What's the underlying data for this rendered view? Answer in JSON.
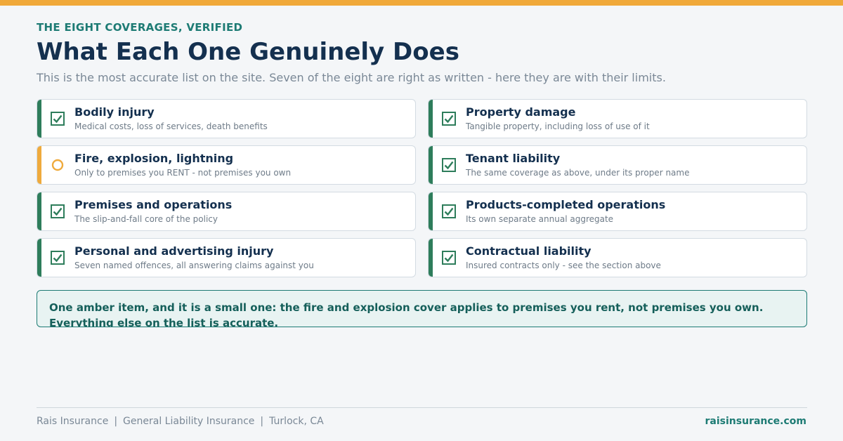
{
  "header": {
    "eyebrow": "THE EIGHT COVERAGES, VERIFIED",
    "title": "What Each One Genuinely Does",
    "subtitle": "This is the most accurate list on the site. Seven of the eight are right as written - here they are with their limits."
  },
  "coverages": [
    {
      "title": "Bodily injury",
      "desc": "Medical costs, loss of services, death benefits",
      "status": "verified"
    },
    {
      "title": "Property damage",
      "desc": "Tangible property, including loss of use of it",
      "status": "verified"
    },
    {
      "title": "Fire, explosion, lightning",
      "desc": "Only to premises you RENT - not premises you own",
      "status": "caution"
    },
    {
      "title": "Tenant liability",
      "desc": "The same coverage as above, under its proper name",
      "status": "verified"
    },
    {
      "title": "Premises and operations",
      "desc": "The slip-and-fall core of the policy",
      "status": "verified"
    },
    {
      "title": "Products-completed operations",
      "desc": "Its own separate annual aggregate",
      "status": "verified"
    },
    {
      "title": "Personal and advertising injury",
      "desc": "Seven named offences, all answering claims against you",
      "status": "verified"
    },
    {
      "title": "Contractual liability",
      "desc": "Insured contracts only - see the section above",
      "status": "verified"
    }
  ],
  "note": {
    "text": "One amber item, and it is a small one: the fire and explosion cover applies to premises you rent, not premises you own. Everything else on the list is accurate."
  },
  "footer": {
    "company": "Rais Insurance",
    "product": "General Liability Insurance",
    "location": "Turlock, CA",
    "website": "raisinsurance.com"
  },
  "colors": {
    "accent_top": "#f0a93a",
    "verified": "#2e7d5b",
    "caution": "#efaa3c",
    "teal": "#1d7b74",
    "navy": "#14304f"
  },
  "icons": {
    "verified": "checked-box-icon",
    "caution": "amber-circle-icon"
  }
}
